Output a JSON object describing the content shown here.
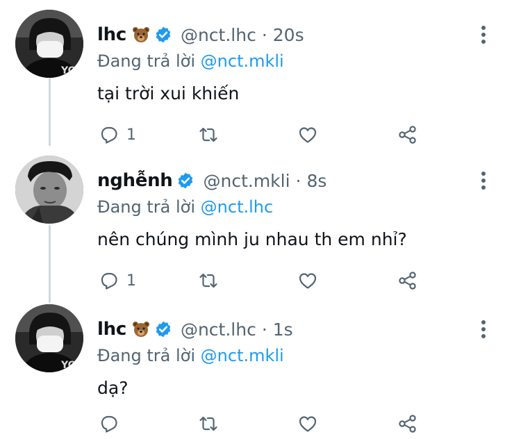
{
  "colors": {
    "accent": "#1d9bf0",
    "secondary_text": "#536471",
    "primary_text": "#0f1419",
    "thread_line": "#cfd9de"
  },
  "tweets": [
    {
      "display_name": "lhc",
      "emoji": "bear-face-emoji",
      "handle": "@nct.lhc",
      "separator": "·",
      "time": "20s",
      "reply_prefix": "Đang trả lời",
      "reply_to": "@nct.mkli",
      "text": "tại trời xui khiến",
      "reply_count": "1"
    },
    {
      "display_name": "nghễnh",
      "emoji": "",
      "handle": "@nct.mkli",
      "separator": "·",
      "time": "8s",
      "reply_prefix": "Đang trả lời",
      "reply_to": "@nct.lhc",
      "text": "nên chúng mình ju nhau th em nhỉ?",
      "reply_count": "1"
    },
    {
      "display_name": "lhc",
      "emoji": "bear-face-emoji",
      "handle": "@nct.lhc",
      "separator": "·",
      "time": "1s",
      "reply_prefix": "Đang trả lời",
      "reply_to": "@nct.mkli",
      "text": "dạ?",
      "reply_count": ""
    }
  ],
  "icons": [
    "reply-icon",
    "retweet-icon",
    "like-icon",
    "share-icon",
    "more-options-icon",
    "verified-badge-icon"
  ]
}
